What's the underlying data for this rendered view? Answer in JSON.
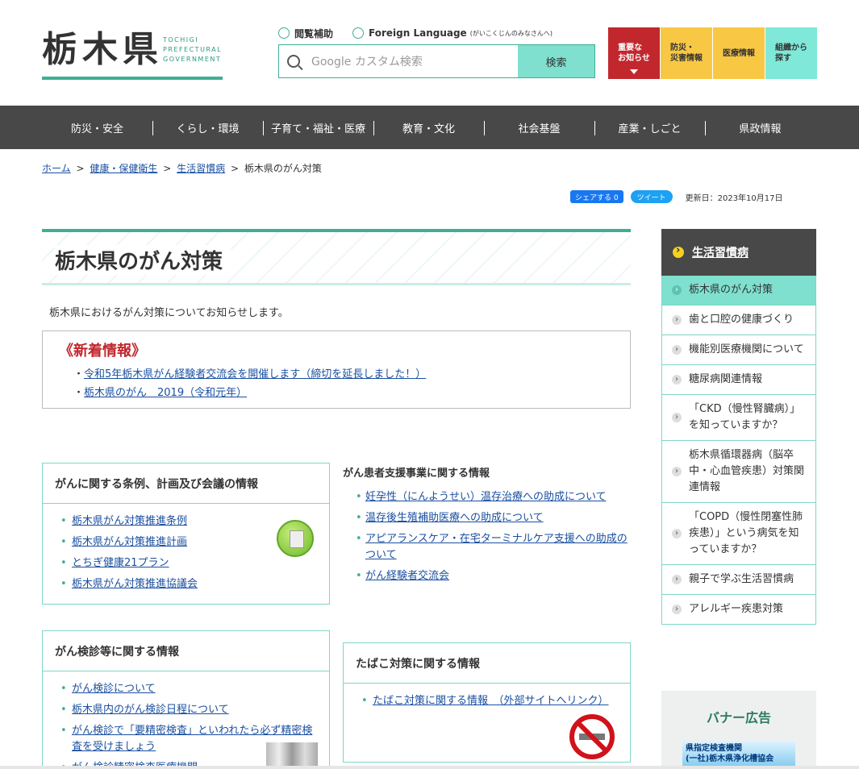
{
  "header": {
    "logo_kanji": "栃木県",
    "logo_en_1": "TOCHIGI",
    "logo_en_2": "PREFECTURAL",
    "logo_en_3": "GOVERNMENT",
    "util_reading": "閲覧補助",
    "util_foreign": "Foreign Language",
    "util_foreign_sub": "(がいこくじんのみなさんへ)",
    "search_placeholder": "Google カスタム検索",
    "search_button": "検索",
    "quick": [
      {
        "label": "重要な\nお知らせ"
      },
      {
        "label": "防災・\n災害情報"
      },
      {
        "label": "医療情報"
      },
      {
        "label": "組織から\n探す"
      }
    ]
  },
  "gnav": [
    "防災・安全",
    "くらし・環境",
    "子育て・福祉・医療",
    "教育・文化",
    "社会基盤",
    "産業・しごと",
    "県政情報"
  ],
  "breadcrumb": {
    "home": "ホーム",
    "c1": "健康・保健衛生",
    "c2": "生活習慣病",
    "current": "栃木県のがん対策",
    "sep": ">"
  },
  "share": {
    "fb": "シェアする 0",
    "tw": "ツイート",
    "updated": "更新日：2023年10月17日"
  },
  "page": {
    "title": "栃木県のがん対策",
    "intro": "栃木県におけるがん対策についてお知らせします。",
    "news_title": "《新着情報》",
    "news": [
      "令和5年栃木県がん経験者交流会を開催します（締切を延長しました！）",
      "栃木県のがん　2019（令和元年）"
    ],
    "card1": {
      "title": "がんに関する条例、計画及び会議の情報",
      "items": [
        "栃木県がん対策推進条例",
        "栃木県がん対策推進計画",
        "とちぎ健康21プラン",
        "栃木県がん対策推進協議会"
      ]
    },
    "card2": {
      "title": "がん患者支援事業に関する情報",
      "items": [
        "妊孕性（にんようせい）温存治療への助成について",
        "温存後生殖補助医療への助成について",
        "アピアランスケア・在宅ターミナルケア支援への助成のついて",
        "がん経験者交流会"
      ]
    },
    "card3": {
      "title": "がん検診等に関する情報",
      "items": [
        "がん検診について",
        "栃木県内のがん検診日程について",
        "がん検診で「要精密検査」といわれたら必ず精密検査を受けましょう",
        "がん検診精密検査医療機関"
      ]
    },
    "card4": {
      "title": "たばこ対策に関する情報",
      "items": [
        "たばこ対策に関する情報　（外部サイトへリンク）"
      ]
    }
  },
  "side": {
    "head": "生活習慣病",
    "items": [
      "栃木県のがん対策",
      "歯と口腔の健康づくり",
      "機能別医療機関について",
      "糖尿病関連情報",
      "「CKD（慢性腎臓病）」を知っていますか？",
      "栃木県循環器病（脳卒中・心血管疾患）対策関連情報",
      "「COPD（慢性閉塞性肺疾患）」という病気を知っていますか？",
      "親子で学ぶ生活習慣病",
      "アレルギー疾患対策"
    ],
    "banner_title": "バナー広告",
    "banner_text1": "県指定検査機関",
    "banner_text2": "(一社)栃木県浄化槽協会"
  }
}
